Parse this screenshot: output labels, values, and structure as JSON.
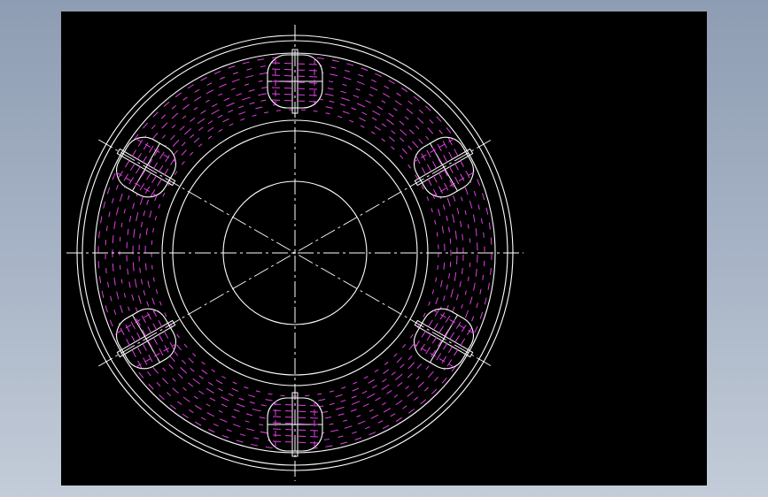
{
  "window": {
    "background_top": "#8e9db3",
    "background_bottom": "#c3ccd8"
  },
  "drawing": {
    "view_background": "#000000",
    "line_color": "#ffffff",
    "hidden_line_color": "#e040e0",
    "pocket_count": 6,
    "pocket_angles_deg": [
      90,
      30,
      -30,
      -90,
      -150,
      150
    ],
    "center_lines": "dash-dot"
  }
}
